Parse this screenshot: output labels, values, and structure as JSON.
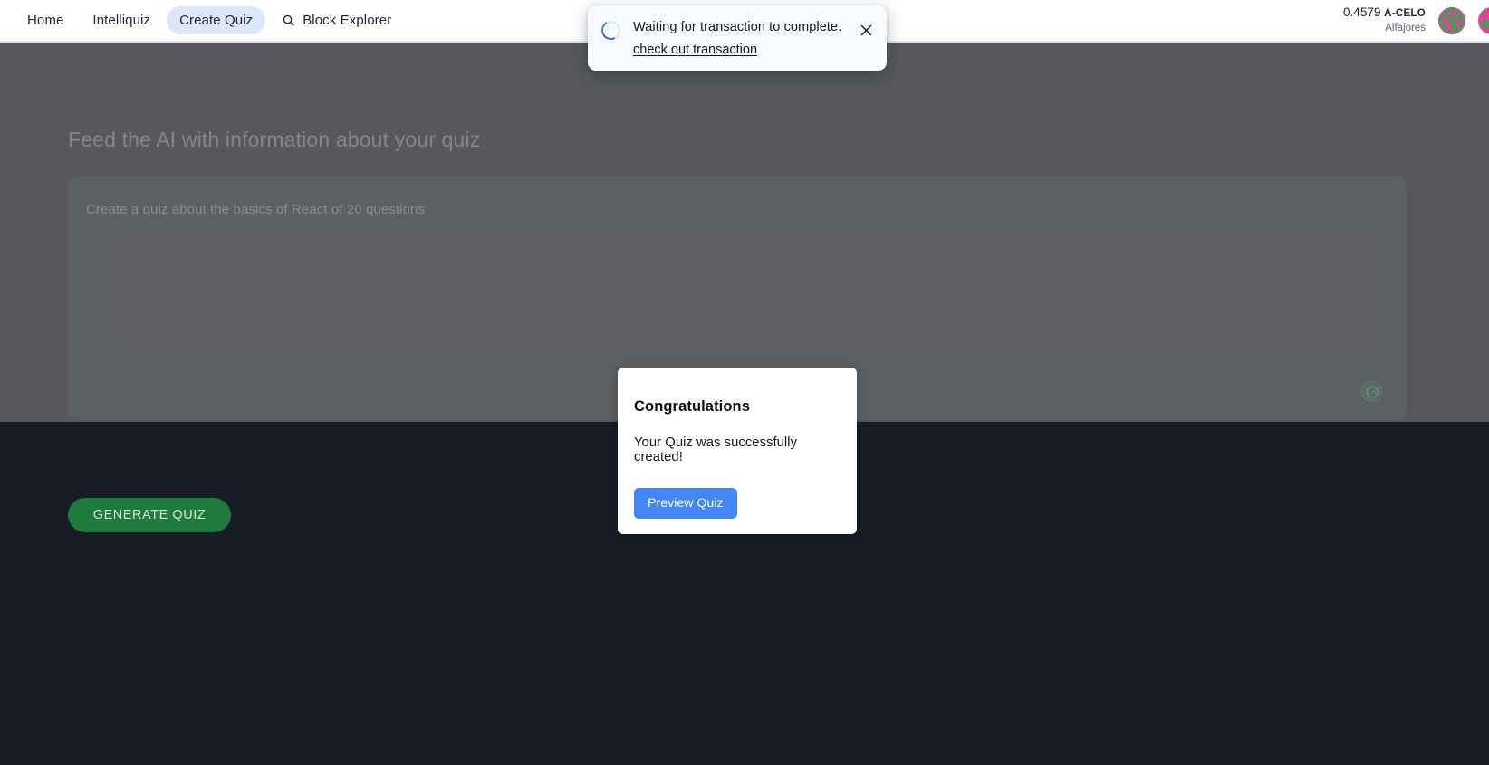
{
  "navbar": {
    "links": [
      {
        "label": "Home",
        "active": false,
        "icon": null
      },
      {
        "label": "Intelliquiz",
        "active": false,
        "icon": null
      },
      {
        "label": "Create Quiz",
        "active": true,
        "icon": null
      },
      {
        "label": "Block Explorer",
        "active": false,
        "icon": "search-icon"
      }
    ],
    "wallet": {
      "balance": "0.4579",
      "currency": "A-CELO",
      "network": "Alfajores",
      "avatar_name": "account-avatar-blockie"
    }
  },
  "toast": {
    "icon": "loading-spinner-icon",
    "message": "Waiting for transaction to complete.",
    "link_label": "check out transaction",
    "close_icon": "close-icon"
  },
  "main": {
    "heading": "Feed the AI with information about your quiz",
    "prompt_placeholder": "Create a quiz about the basics of React of 20 questions",
    "prompt_value": "",
    "badge_icon": "celo-logo-icon",
    "generate_label": "GENERATE QUIZ"
  },
  "modal": {
    "title": "Congratulations",
    "body": "Your Quiz was successfully created!",
    "primary_label": "Preview Quiz"
  },
  "colors": {
    "page_background": "#171c26",
    "navbar_background": "#ffffff",
    "active_pill": "#dde7fb",
    "prompt_background": "#2a3039",
    "generate_button": "#1f7a3e",
    "modal_button": "#4287f5",
    "toast_background": "#f7faff",
    "spinner_accent": "#2f63d4",
    "celo_badge": "#15543f",
    "dim_overlay": "rgba(128,128,128,0.60)"
  }
}
